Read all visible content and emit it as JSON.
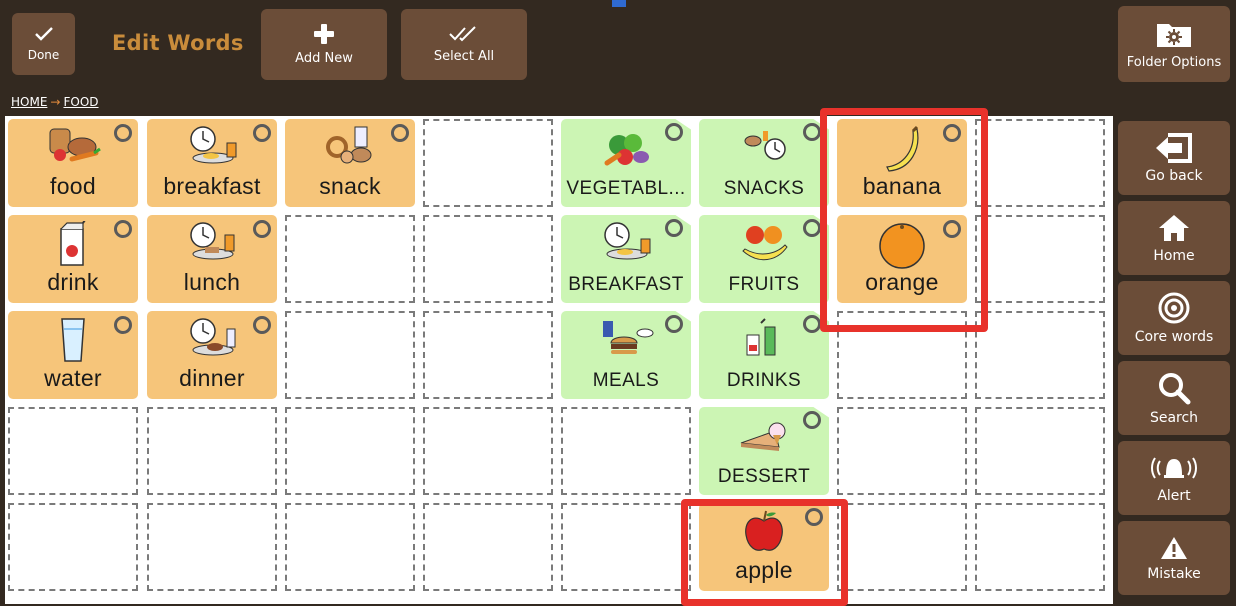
{
  "toolbar": {
    "done_label": "Done",
    "title": "Edit Words",
    "add_new_label": "Add New",
    "select_all_label": "Select All",
    "folder_options_label": "Folder Options"
  },
  "breadcrumb": {
    "home": "HOME",
    "current": "FOOD"
  },
  "tiles": [
    {
      "label": "food",
      "kind": "word",
      "icon": "food-icon"
    },
    {
      "label": "breakfast",
      "kind": "word",
      "icon": "clock-meal-icon"
    },
    {
      "label": "snack",
      "kind": "word",
      "icon": "snack-icon"
    },
    {
      "label": "VEGETABL...",
      "kind": "folder",
      "icon": "vegetables-icon"
    },
    {
      "label": "SNACKS",
      "kind": "folder",
      "icon": "snacks-icon"
    },
    {
      "label": "banana",
      "kind": "word",
      "icon": "banana-icon"
    },
    {
      "label": "drink",
      "kind": "word",
      "icon": "juice-box-icon"
    },
    {
      "label": "lunch",
      "kind": "word",
      "icon": "clock-meal-icon"
    },
    {
      "label": "BREAKFAST",
      "kind": "folder",
      "icon": "clock-meal-icon"
    },
    {
      "label": "FRUITS",
      "kind": "folder",
      "icon": "fruits-icon"
    },
    {
      "label": "orange",
      "kind": "word",
      "icon": "orange-icon"
    },
    {
      "label": "water",
      "kind": "word",
      "icon": "glass-icon"
    },
    {
      "label": "dinner",
      "kind": "word",
      "icon": "clock-meal-icon"
    },
    {
      "label": "MEALS",
      "kind": "folder",
      "icon": "meals-icon"
    },
    {
      "label": "DRINKS",
      "kind": "folder",
      "icon": "drinks-icon"
    },
    {
      "label": "DESSERT",
      "kind": "folder",
      "icon": "pie-icon"
    },
    {
      "label": "apple",
      "kind": "word",
      "icon": "apple-icon"
    }
  ],
  "sidebar": {
    "go_back_label": "Go back",
    "home_label": "Home",
    "core_words_label": "Core words",
    "search_label": "Search",
    "alert_label": "Alert",
    "mistake_label": "Mistake"
  },
  "colors": {
    "background": "#332920",
    "button": "#6b4d38",
    "word_tile": "#f6c57a",
    "folder_tile": "#ccf5b4",
    "title": "#c98c3b",
    "highlight": "#e8322b"
  }
}
